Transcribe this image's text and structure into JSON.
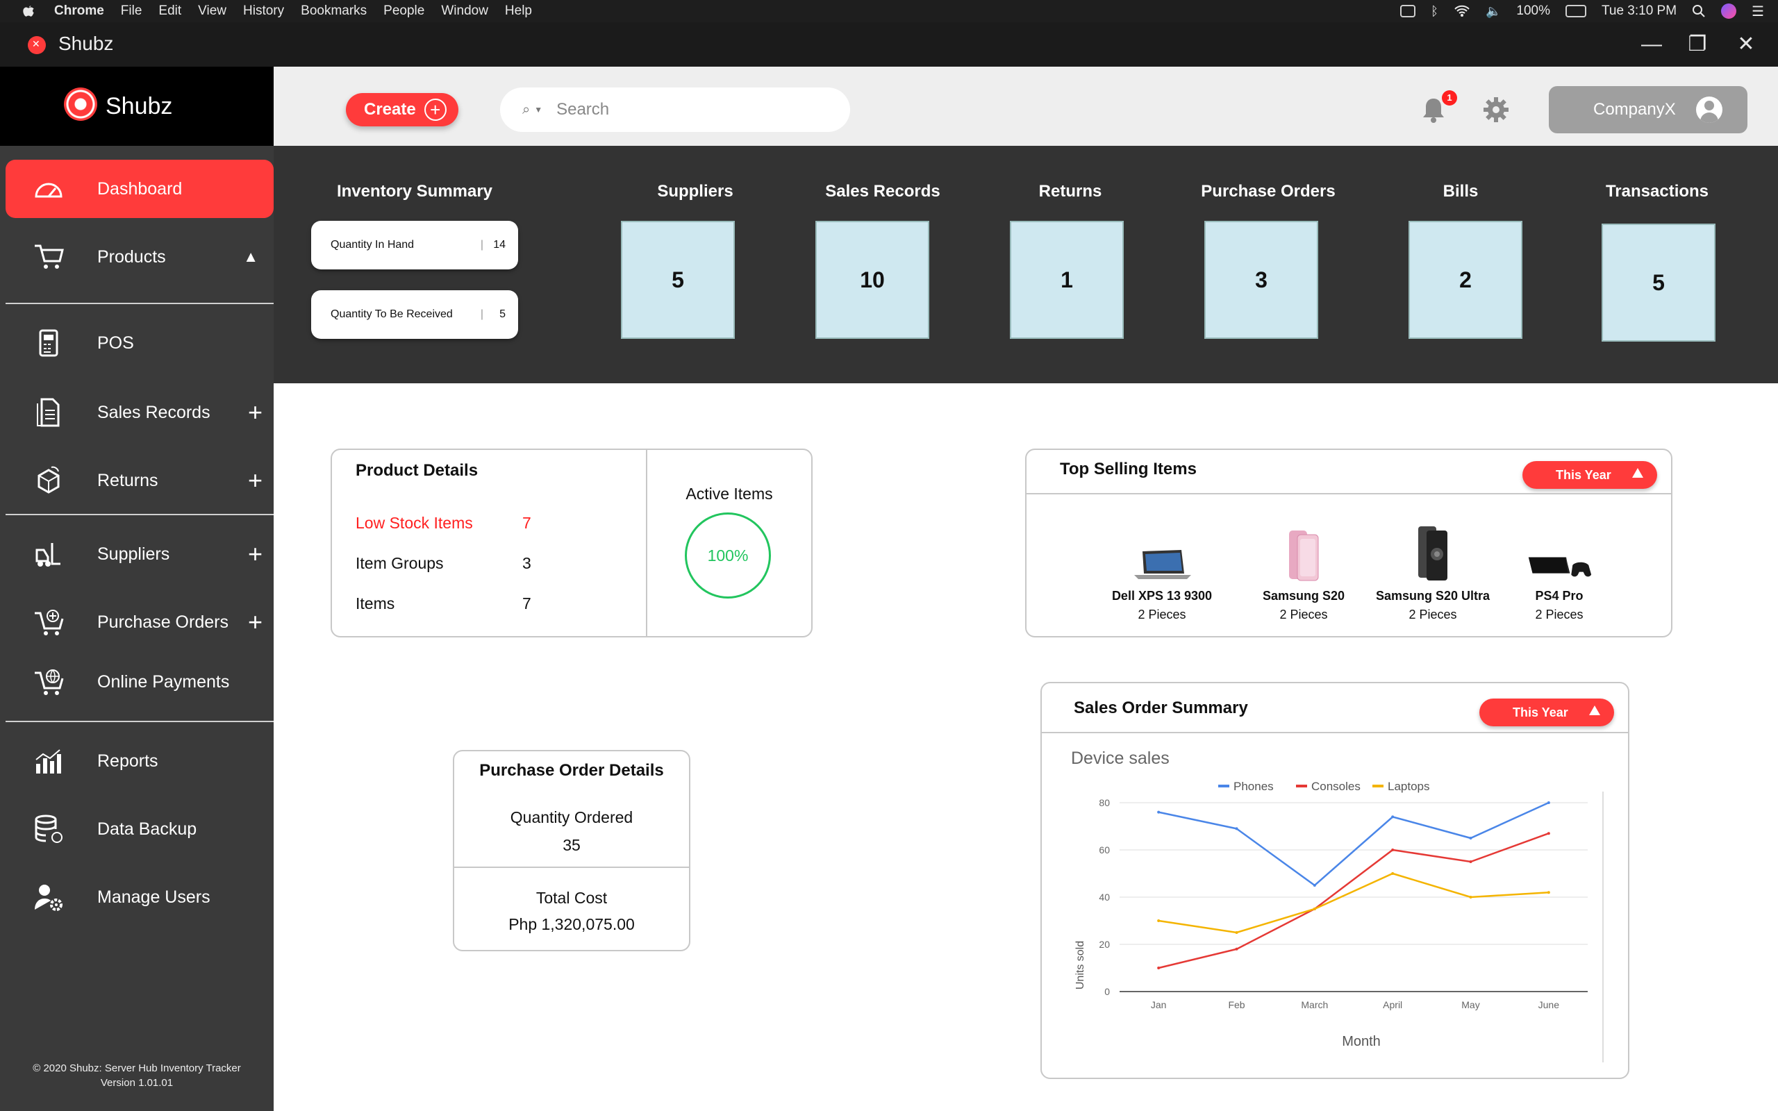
{
  "menubar": {
    "app": "Chrome",
    "items": [
      "File",
      "Edit",
      "View",
      "History",
      "Bookmarks",
      "People",
      "Window",
      "Help"
    ],
    "battery": "100%",
    "clock": "Tue 3:10 PM"
  },
  "window": {
    "title": "Shubz"
  },
  "sidebar": {
    "brand": "Shubz",
    "items": [
      {
        "label": "Dashboard",
        "icon": "gauge-icon"
      },
      {
        "label": "Products",
        "icon": "cart-icon"
      },
      {
        "label": "POS",
        "icon": "pos-terminal-icon"
      },
      {
        "label": "Sales Records",
        "icon": "document-icon"
      },
      {
        "label": "Returns",
        "icon": "box-return-icon"
      },
      {
        "label": "Suppliers",
        "icon": "forklift-icon"
      },
      {
        "label": "Purchase Orders",
        "icon": "cart-plus-icon"
      },
      {
        "label": "Online Payments",
        "icon": "cart-globe-icon"
      },
      {
        "label": "Reports",
        "icon": "bar-chart-icon"
      },
      {
        "label": "Data Backup",
        "icon": "database-icon"
      },
      {
        "label": "Manage Users",
        "icon": "user-gear-icon"
      }
    ],
    "footer_line1": "© 2020 Shubz: Server Hub Inventory Tracker",
    "footer_line2": "Version 1.01.01"
  },
  "header": {
    "create_label": "Create",
    "search_placeholder": "Search",
    "notification_count": "1",
    "account_label": "CompanyX"
  },
  "summary": {
    "inventory_title": "Inventory Summary",
    "qty_in_hand_label": "Quantity In Hand",
    "qty_in_hand": "14",
    "qty_to_receive_label": "Quantity To Be Received",
    "qty_to_receive": "5",
    "stats": [
      {
        "title": "Suppliers",
        "value": "5"
      },
      {
        "title": "Sales Records",
        "value": "10"
      },
      {
        "title": "Returns",
        "value": "1"
      },
      {
        "title": "Purchase Orders",
        "value": "3"
      },
      {
        "title": "Bills",
        "value": "2"
      },
      {
        "title": "Transactions",
        "value": "5"
      }
    ]
  },
  "product_details": {
    "title": "Product Details",
    "rows": [
      {
        "label": "Low Stock Items",
        "value": "7"
      },
      {
        "label": "Item Groups",
        "value": "3"
      },
      {
        "label": "Items",
        "value": "7"
      }
    ],
    "active_label": "Active Items",
    "active_value": "100%"
  },
  "purchase_order_details": {
    "title": "Purchase Order Details",
    "qty_label": "Quantity Ordered",
    "qty_value": "35",
    "cost_label": "Total Cost",
    "cost_value": "Php 1,320,075.00"
  },
  "top_selling": {
    "title": "Top Selling Items",
    "filter": "This Year",
    "items": [
      {
        "name": "Dell XPS 13 9300",
        "qty": "2 Pieces"
      },
      {
        "name": "Samsung S20",
        "qty": "2 Pieces"
      },
      {
        "name": "Samsung S20 Ultra",
        "qty": "2 Pieces"
      },
      {
        "name": "PS4 Pro",
        "qty": "2 Pieces"
      }
    ]
  },
  "sales_order_summary": {
    "title": "Sales Order Summary",
    "filter": "This Year"
  },
  "colors": {
    "accent": "#ff3b3b",
    "phones": "#4a86e8",
    "consoles": "#e53935",
    "laptops": "#f4b400",
    "stat_box": "#cfe8f0"
  },
  "chart_data": {
    "type": "line",
    "title": "Device sales",
    "xlabel": "Month",
    "ylabel": "Units sold",
    "categories": [
      "Jan",
      "Feb",
      "March",
      "April",
      "May",
      "June"
    ],
    "ylim": [
      0,
      80
    ],
    "yticks": [
      "0",
      "20",
      "40",
      "60",
      "80"
    ],
    "legend_position": "top",
    "grid": "horizontal",
    "series": [
      {
        "name": "Phones",
        "values": [
          76,
          69,
          45,
          74,
          65,
          80
        ]
      },
      {
        "name": "Consoles",
        "values": [
          10,
          18,
          35,
          60,
          55,
          67
        ]
      },
      {
        "name": "Laptops",
        "values": [
          30,
          25,
          35,
          50,
          40,
          42
        ]
      }
    ]
  }
}
